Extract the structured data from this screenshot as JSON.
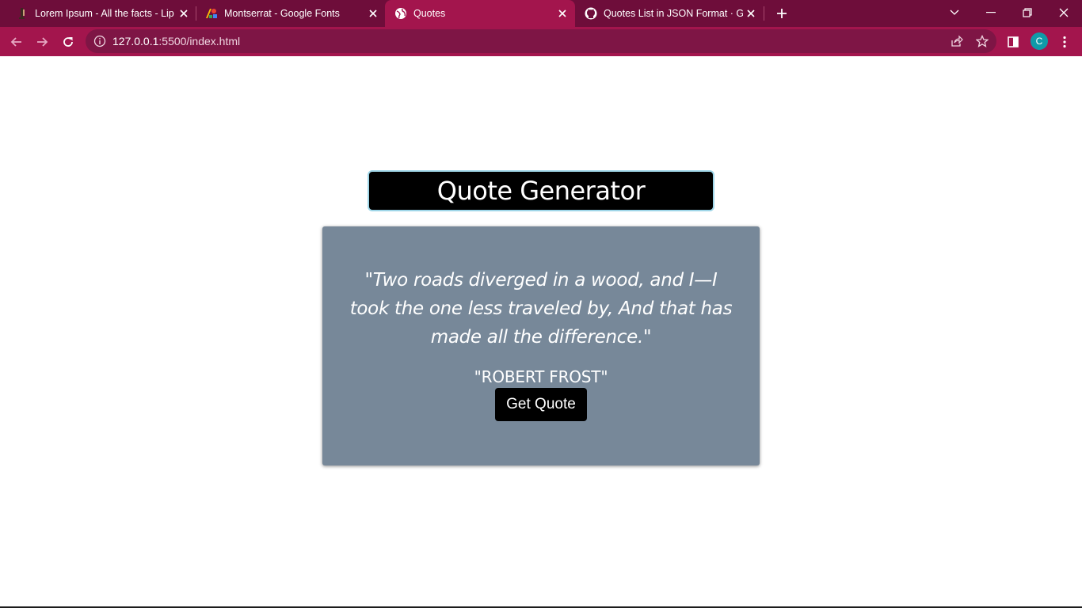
{
  "browser": {
    "tabs": [
      {
        "title": "Lorem Ipsum - All the facts - Lips",
        "icon": "lipsum-icon"
      },
      {
        "title": "Montserrat - Google Fonts",
        "icon": "google-fonts-icon"
      },
      {
        "title": "Quotes",
        "icon": "globe-icon",
        "active": true
      },
      {
        "title": "Quotes List in JSON Format · Git",
        "icon": "github-icon"
      }
    ],
    "address": {
      "host": "127.0.0.1",
      "path": ":5500/index.html"
    },
    "profile_initial": "C"
  },
  "page": {
    "heading": "Quote Generator",
    "quote": "\"Two roads diverged in a wood, and I—I took the one less traveled by, And that has made all the difference.\"",
    "author": "\"ROBERT FROST\"",
    "button_label": "Get Quote"
  },
  "colors": {
    "tabstrip": "#6e0d3a",
    "accent": "#a3154d",
    "card": "#778899",
    "heading_bg": "#000000",
    "heading_border": "#9fd6e8"
  }
}
